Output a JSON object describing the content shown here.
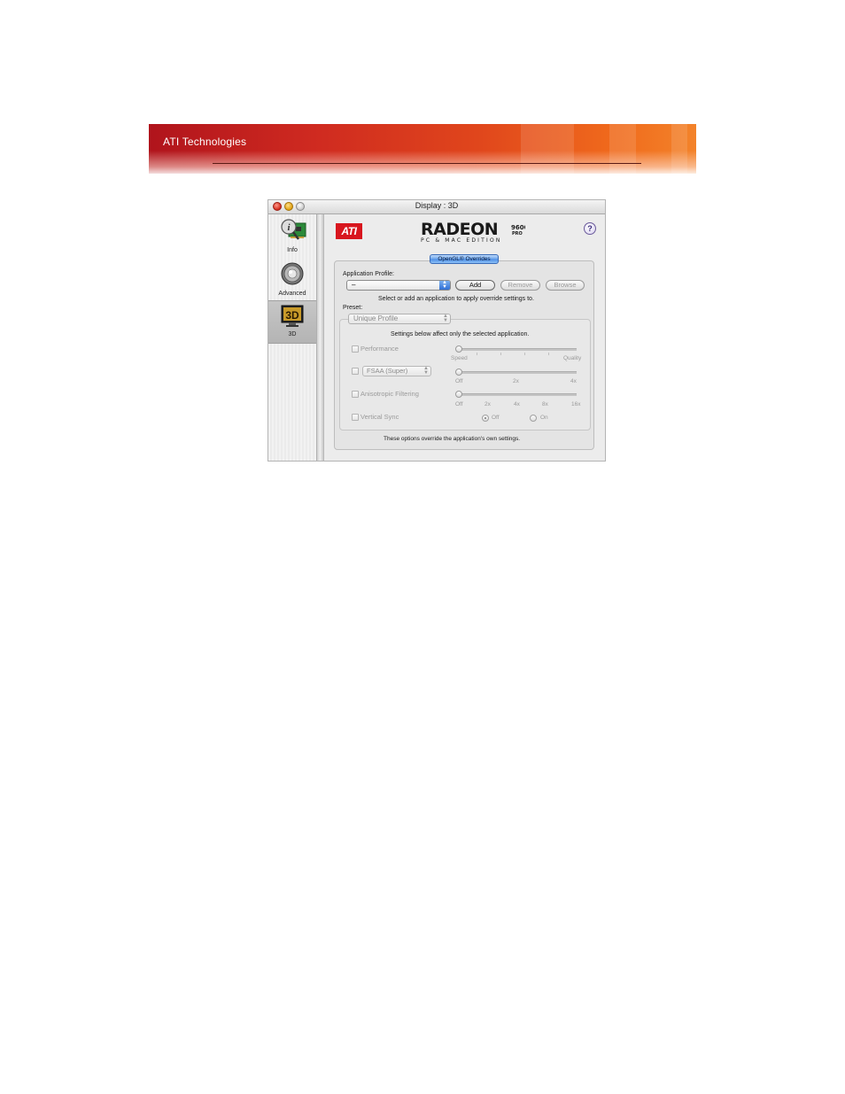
{
  "banner": {
    "title": "ATI Technologies"
  },
  "window": {
    "title": "Display : 3D",
    "controls": [
      "close",
      "minimize",
      "zoom"
    ]
  },
  "sidebar": {
    "items": [
      {
        "label": "Info",
        "icon": "info-card-icon",
        "selected": false
      },
      {
        "label": "Advanced",
        "icon": "speaker-knob-icon",
        "selected": false
      },
      {
        "label": "3D",
        "icon": "3d-monitor-icon",
        "selected": true
      }
    ]
  },
  "header": {
    "ati_logo": "ATI",
    "product_logo": "RADEON 9600 PRO PC & MAC EDITION",
    "help_label": "?"
  },
  "opengl": {
    "tab_label": "OpenGL® Overrides",
    "app_profile_label": "Application Profile:",
    "app_profile_value": "–",
    "add_label": "Add",
    "remove_label": "Remove",
    "browse_label": "Browse",
    "hint": "Select or add an application to apply override settings to.",
    "preset_label": "Preset:",
    "preset_value": "Unique Profile",
    "settings_note": "Settings below affect only the selected application.",
    "performance": {
      "label": "Performance",
      "min_label": "Speed",
      "max_label": "Quality",
      "checked": false
    },
    "fsaa": {
      "select_value": "FSAA (Super)",
      "ticks": [
        "Off",
        "2x",
        "4x"
      ],
      "checked": false
    },
    "anisotropic": {
      "label": "Anisotropic Filtering",
      "ticks": [
        "Off",
        "2x",
        "4x",
        "8x",
        "16x"
      ],
      "checked": false
    },
    "vsync": {
      "label": "Vertical Sync",
      "options": [
        "Off",
        "On"
      ],
      "selected": "Off",
      "checked": false
    },
    "footer_note": "These options override the application's own settings."
  },
  "colors": {
    "banner_red": "#c8241e",
    "accent_blue": "#4c8ee6",
    "ati_red": "#d8161e"
  }
}
